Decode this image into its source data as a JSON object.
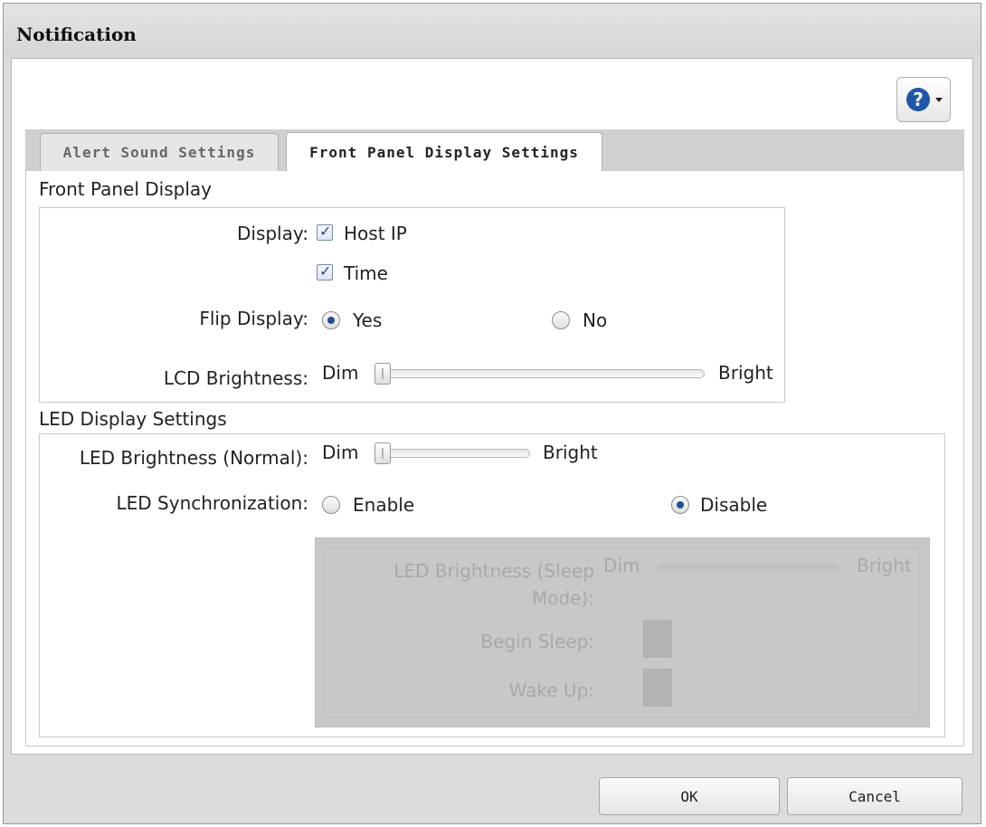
{
  "dialog": {
    "title": "Notification"
  },
  "help": {
    "glyph": "?"
  },
  "tabs": [
    {
      "label": "Alert Sound Settings",
      "active": false
    },
    {
      "label": "Front Panel Display Settings",
      "active": true
    }
  ],
  "front_panel": {
    "section_title": "Front Panel Display",
    "display_label": "Display:",
    "host_ip": {
      "label": "Host IP",
      "checked": true
    },
    "time": {
      "label": "Time",
      "checked": true
    },
    "flip_label": "Flip Display:",
    "flip_yes": {
      "label": "Yes",
      "selected": true
    },
    "flip_no": {
      "label": "No",
      "selected": false
    },
    "lcd_label": "LCD Brightness:",
    "lcd_dim": "Dim",
    "lcd_bright": "Bright"
  },
  "led": {
    "section_title": "LED Display Settings",
    "normal_label": "LED Brightness (Normal):",
    "normal_dim": "Dim",
    "normal_bright": "Bright",
    "sync_label": "LED Synchronization:",
    "sync_enable": {
      "label": "Enable",
      "selected": false
    },
    "sync_disable": {
      "label": "Disable",
      "selected": true
    },
    "sleep_label_line1": "LED Brightness (Sleep",
    "sleep_label_line2": "Mode):",
    "sleep_dim": "Dim",
    "sleep_bright": "Bright",
    "begin_sleep_label": "Begin Sleep:",
    "wake_up_label": "Wake Up:"
  },
  "footer": {
    "ok_label": "OK",
    "cancel_label": "Cancel"
  },
  "colors": {
    "accent": "#1f57a8",
    "disabled_bg": "#c8c8c8"
  }
}
